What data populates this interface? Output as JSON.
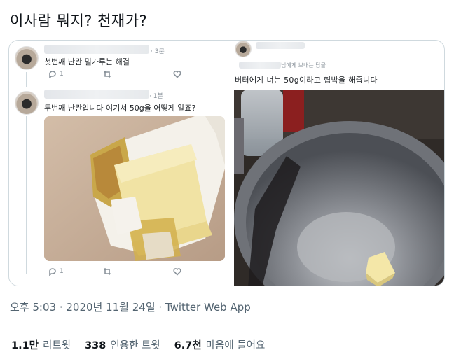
{
  "tweet": {
    "text": "이사람 뭐지? 천재가?",
    "meta": "오후 5:03 · 2020년 11월 24일 · Twitter Web App"
  },
  "thread": [
    {
      "time": "· 3분",
      "text": "첫번째 난관 밀가루는 해결",
      "reply_count": "1",
      "retweet_count": "",
      "like_count": ""
    },
    {
      "time": "· 1분",
      "text": "두번째 난관입니다 여기서 50g을 어떻게 알죠?",
      "reply_count": "1",
      "retweet_count": "",
      "like_count": ""
    }
  ],
  "quote": {
    "sub_label": "님에게 보내는 답글",
    "text": "버터에게 너는 50g이라고 협박을 해줍니다"
  },
  "stats": {
    "retweets_value": "1.1만",
    "retweets_label": "리트윗",
    "quotes_value": "338",
    "quotes_label": "인용한 트윗",
    "likes_value": "6.7천",
    "likes_label": "마음에 들어요"
  },
  "icons": [
    "reply-icon",
    "retweet-icon",
    "like-icon"
  ],
  "colors": {
    "muted": "#536471",
    "border": "#cfd9de"
  }
}
